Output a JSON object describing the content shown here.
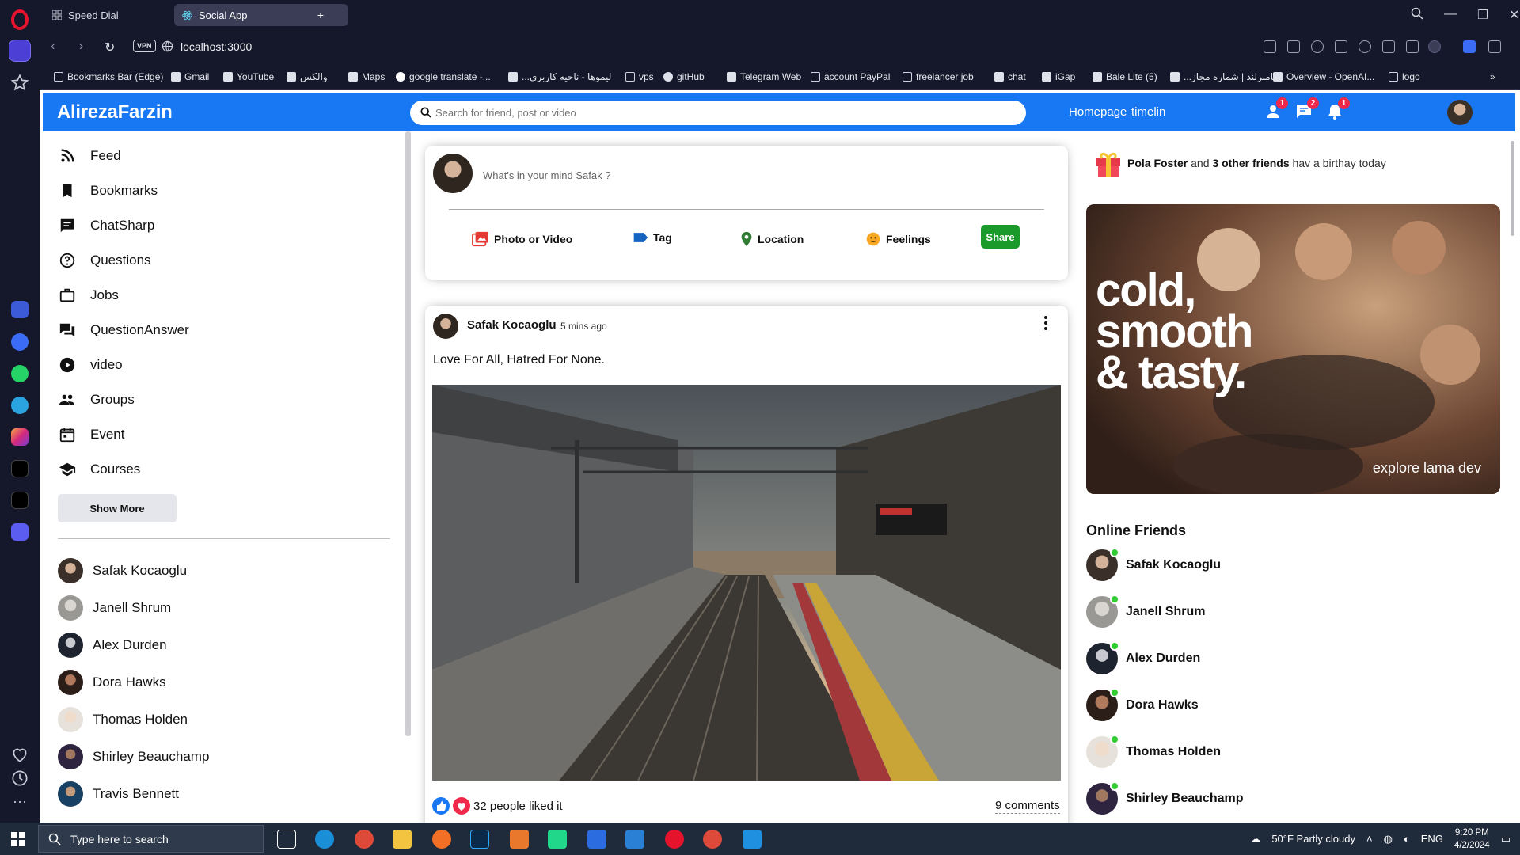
{
  "browser": {
    "tabs": [
      {
        "label": "Speed Dial",
        "active": false
      },
      {
        "label": "Social App",
        "active": true
      }
    ],
    "vpn_label": "VPN",
    "url": "localhost:3000",
    "bookmarks": [
      {
        "label": "Bookmarks Bar (Edge)",
        "icon": "folder-icon"
      },
      {
        "label": "Gmail",
        "icon": "doc-icon"
      },
      {
        "label": "YouTube",
        "icon": "doc-icon"
      },
      {
        "label": "والکس",
        "icon": "doc-icon"
      },
      {
        "label": "Maps",
        "icon": "doc-icon"
      },
      {
        "label": "google translate -...",
        "icon": "google-icon"
      },
      {
        "label": "...لیموها - ناحیه کاربری",
        "icon": "doc-icon"
      },
      {
        "label": "vps",
        "icon": "folder-icon"
      },
      {
        "label": "gitHub",
        "icon": "github-icon"
      },
      {
        "label": "Telegram Web",
        "icon": "doc-icon"
      },
      {
        "label": "account PayPal",
        "icon": "folder-icon"
      },
      {
        "label": "freelancer job",
        "icon": "folder-icon"
      },
      {
        "label": "chat",
        "icon": "doc-icon"
      },
      {
        "label": "iGap",
        "icon": "doc-icon"
      },
      {
        "label": "Bale Lite (5)",
        "icon": "doc-icon"
      },
      {
        "label": "...نامبرلند | شماره مجاز",
        "icon": "doc-icon"
      },
      {
        "label": "Overview - OpenAI...",
        "icon": "doc-icon"
      },
      {
        "label": "logo",
        "icon": "folder-icon"
      }
    ]
  },
  "app": {
    "brand": "AlirezaFarzin",
    "search_placeholder": "Search for friend, post or video",
    "nav_links": [
      "Homepage",
      "timelin"
    ],
    "badges": {
      "friends": "1",
      "messages": "2",
      "notifications": "1"
    },
    "accent_color": "#1877f2"
  },
  "sidebar": {
    "menu": [
      {
        "label": "Feed",
        "icon": "rss-icon"
      },
      {
        "label": "Bookmarks",
        "icon": "bookmark-icon"
      },
      {
        "label": "ChatSharp",
        "icon": "chat-icon"
      },
      {
        "label": "Questions",
        "icon": "help-icon"
      },
      {
        "label": "Jobs",
        "icon": "briefcase-icon"
      },
      {
        "label": "QuestionAnswer",
        "icon": "question-answer-icon"
      },
      {
        "label": "video",
        "icon": "play-circle-icon"
      },
      {
        "label": "Groups",
        "icon": "group-icon"
      },
      {
        "label": "Event",
        "icon": "calendar-icon"
      },
      {
        "label": "Courses",
        "icon": "school-icon"
      }
    ],
    "show_more": "Show More",
    "friends": [
      "Safak Kocaoglu",
      "Janell Shrum",
      "Alex Durden",
      "Dora Hawks",
      "Thomas Holden",
      "Shirley Beauchamp",
      "Travis Bennett"
    ]
  },
  "share": {
    "placeholder": "What's in your mind Safak ?",
    "options": [
      {
        "label": "Photo or Video",
        "icon": "perm-media-icon",
        "color": "#e53935"
      },
      {
        "label": "Tag",
        "icon": "label-icon",
        "color": "#1565c0"
      },
      {
        "label": "Location",
        "icon": "room-icon",
        "color": "#2e7d32"
      },
      {
        "label": "Feelings",
        "icon": "emoji-icon",
        "color": "#f9a825"
      }
    ],
    "button": "Share"
  },
  "post": {
    "author": "Safak Kocaoglu",
    "time": "5 mins ago",
    "text": "Love For All, Hatred For None.",
    "likes": "32 people liked it",
    "comments": "9 comments"
  },
  "rightbar": {
    "birthday": {
      "name": "Pola Foster",
      "mid": " and ",
      "others": "3 other friends",
      "suffix": " hav a birthay today"
    },
    "ad": {
      "line1": "cold,",
      "line2": "smooth",
      "line3": "& tasty.",
      "caption": "explore lama dev"
    },
    "online_title": "Online Friends",
    "online": [
      "Safak Kocaoglu",
      "Janell Shrum",
      "Alex Durden",
      "Dora Hawks",
      "Thomas Holden",
      "Shirley Beauchamp"
    ]
  },
  "taskbar": {
    "search_placeholder": "Type here to search",
    "weather": "50°F  Partly cloudy",
    "lang": "ENG",
    "time": "9:20 PM",
    "date": "4/2/2024"
  }
}
